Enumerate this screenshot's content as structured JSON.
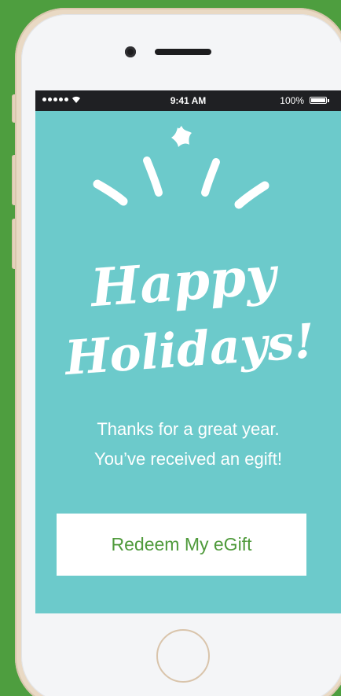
{
  "status_bar": {
    "time": "9:41 AM",
    "battery": "100%"
  },
  "greeting": {
    "line1": "Happy",
    "line2": "Holidays!"
  },
  "message": {
    "line1": "Thanks for a great year.",
    "line2": "You’ve received an egift!"
  },
  "cta": {
    "label": "Redeem My eGift"
  },
  "colors": {
    "background": "#4e9e3f",
    "screen": "#6ccacb",
    "button_text": "#4f9a3b"
  }
}
